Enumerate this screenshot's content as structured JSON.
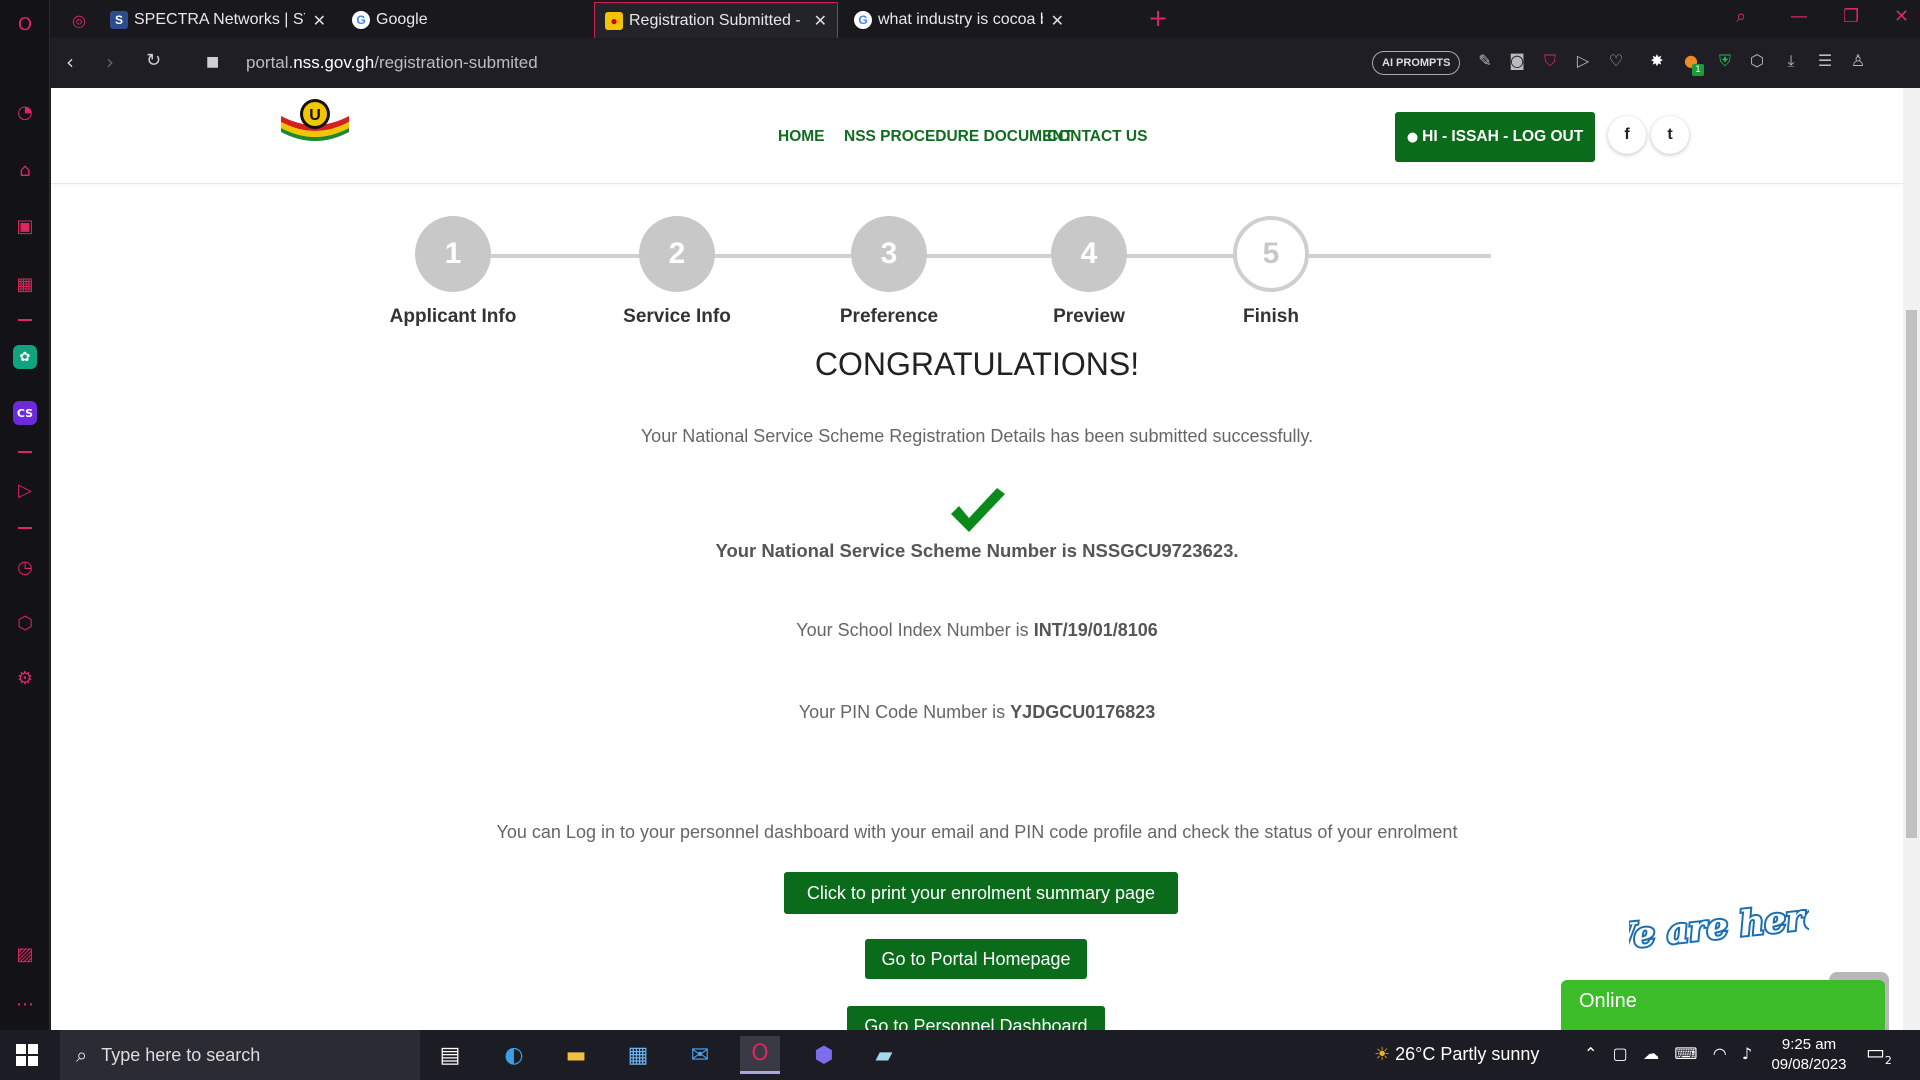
{
  "browser": {
    "tabs": [
      {
        "title": "SPECTRA Networks | STAY S"
      },
      {
        "title": "Google"
      },
      {
        "title": "Registration Submitted - N"
      },
      {
        "title": "what industry is cocoa boar"
      }
    ],
    "url_prefix": "portal.",
    "url_domain": "nss.gov.gh",
    "url_path": "/registration-submited",
    "ai_prompts_label": "AI PROMPTS",
    "extension_badge": "1"
  },
  "site": {
    "nav": {
      "home": "HOME",
      "procedure": "NSS PROCEDURE DOCUMENT",
      "contact": "CONTACT US",
      "logout": "HI - ISSAH - LOG OUT"
    },
    "social": {
      "facebook": "f",
      "twitter": "t"
    }
  },
  "stepper": [
    {
      "number": "1",
      "label": "Applicant Info"
    },
    {
      "number": "2",
      "label": "Service Info"
    },
    {
      "number": "3",
      "label": "Preference"
    },
    {
      "number": "4",
      "label": "Preview"
    },
    {
      "number": "5",
      "label": "Finish"
    }
  ],
  "content": {
    "heading": "CONGRATULATIONS!",
    "submitted_text": "Your National Service Scheme Registration Details has been submitted successfully.",
    "nss_number_text": "Your National Service Scheme Number is NSSGCU9723623.",
    "index_prefix": "Your School Index Number is ",
    "index_value": "INT/19/01/8106",
    "pin_prefix": "Your PIN Code Number is ",
    "pin_value": "YJDGCU0176823",
    "dashboard_note": "You can Log in to your personnel dashboard with your email and PIN code profile and check the status of your enrolment",
    "print_button": "Click to print your enrolment summary page",
    "homepage_button": "Go to Portal Homepage",
    "dashboard_button": "Go to Personnel Dashboard",
    "check_color": "#0a8a1a"
  },
  "chat": {
    "banner": "We are here!",
    "status": "Online"
  },
  "taskbar": {
    "search_placeholder": "Type here to search",
    "weather": "26°C  Partly sunny",
    "time": "9:25 am",
    "date": "09/08/2023",
    "notification_count": "2"
  }
}
